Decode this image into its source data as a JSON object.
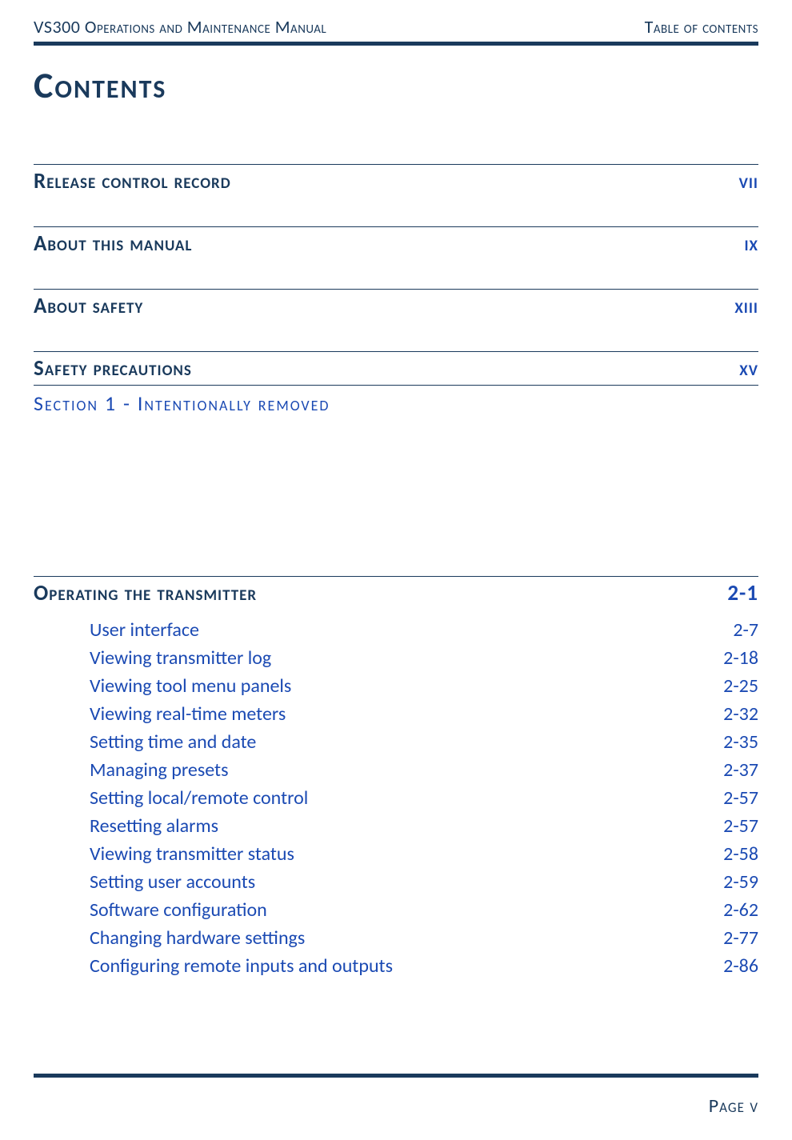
{
  "header": {
    "left": "VS300 Operations and Maintenance Manual",
    "right": "Table of contents"
  },
  "title": "Contents",
  "sections": [
    {
      "label": "Release control record",
      "page": "vii"
    },
    {
      "label": "About this manual",
      "page": "ix"
    },
    {
      "label": "About safety",
      "page": "xiii"
    },
    {
      "label": "Safety precautions",
      "page": "xv"
    }
  ],
  "removed": "Section 1 - Intentionally removed",
  "section2": {
    "label": "Operating the transmitter",
    "page": "2-1",
    "items": [
      {
        "label": "User interface",
        "page": "2-7"
      },
      {
        "label": "Viewing transmitter log",
        "page": "2-18"
      },
      {
        "label": "Viewing tool menu panels",
        "page": "2-25"
      },
      {
        "label": "Viewing real-time meters",
        "page": "2-32"
      },
      {
        "label": "Setting time and date",
        "page": "2-35"
      },
      {
        "label": "Managing presets",
        "page": "2-37"
      },
      {
        "label": "Setting local/remote control",
        "page": "2-57"
      },
      {
        "label": "Resetting alarms",
        "page": "2-57"
      },
      {
        "label": "Viewing transmitter status",
        "page": "2-58"
      },
      {
        "label": "Setting user accounts",
        "page": "2-59"
      },
      {
        "label": "Software configuration",
        "page": "2-62"
      },
      {
        "label": "Changing hardware settings",
        "page": "2-77"
      },
      {
        "label": "Configuring remote inputs and outputs",
        "page": "2-86"
      }
    ]
  },
  "footer": "Page v"
}
